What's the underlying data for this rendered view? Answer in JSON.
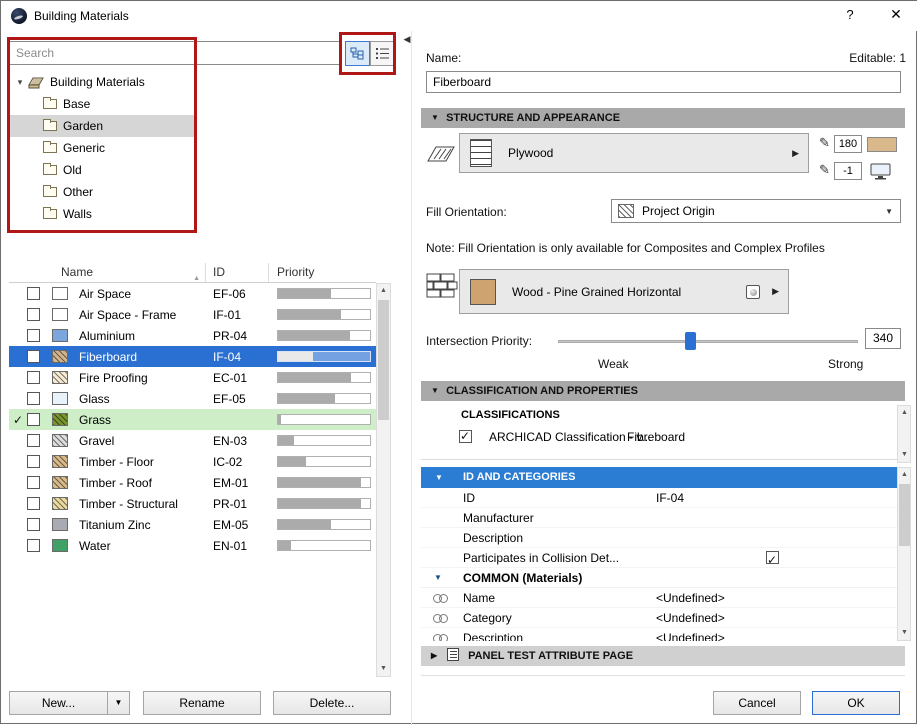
{
  "window": {
    "title": "Building Materials",
    "help": "?",
    "close": "✕"
  },
  "search": {
    "placeholder": "Search"
  },
  "view_toggle": {
    "tree_selected": true
  },
  "tree": {
    "root": "Building Materials",
    "folders": [
      {
        "label": "Base",
        "selected": false
      },
      {
        "label": "Garden",
        "selected": true
      },
      {
        "label": "Generic",
        "selected": false
      },
      {
        "label": "Old",
        "selected": false
      },
      {
        "label": "Other",
        "selected": false
      },
      {
        "label": "Walls",
        "selected": false
      }
    ]
  },
  "table": {
    "columns": [
      "Name",
      "ID",
      "Priority"
    ],
    "sorted_by": "Name",
    "rows": [
      {
        "name": "Air Space",
        "id": "EF-06",
        "priority": 58,
        "swatch": "#ffffff",
        "pattern": "plain",
        "selected": false,
        "active": false
      },
      {
        "name": "Air Space - Frame",
        "id": "IF-01",
        "priority": 68,
        "swatch": "#ffffff",
        "pattern": "plain",
        "selected": false,
        "active": false
      },
      {
        "name": "Aluminium",
        "id": "PR-04",
        "priority": 78,
        "swatch": "#7da7dc",
        "pattern": "plain",
        "selected": false,
        "active": false
      },
      {
        "name": "Fiberboard",
        "id": "IF-04",
        "priority": 38,
        "swatch": "#d2b48c",
        "pattern": "hatch",
        "selected": true,
        "active": false
      },
      {
        "name": "Fire Proofing",
        "id": "EC-01",
        "priority": 79,
        "swatch": "#f7ead2",
        "pattern": "hatch",
        "selected": false,
        "active": false
      },
      {
        "name": "Glass",
        "id": "EF-05",
        "priority": 62,
        "swatch": "#e8f2fb",
        "pattern": "plain",
        "selected": false,
        "active": false
      },
      {
        "name": "Grass",
        "id": "",
        "priority": 3,
        "swatch": "#79952e",
        "pattern": "hatch",
        "selected": false,
        "active": true
      },
      {
        "name": "Gravel",
        "id": "EN-03",
        "priority": 17,
        "swatch": "#dcdcdc",
        "pattern": "hatch",
        "selected": false,
        "active": false
      },
      {
        "name": "Timber - Floor",
        "id": "IC-02",
        "priority": 30,
        "swatch": "#d8b98a",
        "pattern": "hatch",
        "selected": false,
        "active": false
      },
      {
        "name": "Timber - Roof",
        "id": "EM-01",
        "priority": 90,
        "swatch": "#d8b98a",
        "pattern": "hatch",
        "selected": false,
        "active": false
      },
      {
        "name": "Timber - Structural",
        "id": "PR-01",
        "priority": 90,
        "swatch": "#ead9a0",
        "pattern": "hatch",
        "selected": false,
        "active": false
      },
      {
        "name": "Titanium Zinc",
        "id": "EM-05",
        "priority": 58,
        "swatch": "#a9abb3",
        "pattern": "plain",
        "selected": false,
        "active": false
      },
      {
        "name": "Water",
        "id": "EN-01",
        "priority": 14,
        "swatch": "#41a066",
        "pattern": "plain",
        "selected": false,
        "active": false
      }
    ]
  },
  "left_buttons": {
    "new": "New...",
    "rename": "Rename",
    "delete": "Delete..."
  },
  "right": {
    "name_label": "Name:",
    "editable": "Editable: 1",
    "name_value": "Fiberboard",
    "sections": {
      "structure": "STRUCTURE AND APPEARANCE",
      "classification": "CLASSIFICATION AND PROPERTIES",
      "panel_test": "PANEL TEST ATTRIBUTE PAGE"
    },
    "cut_fill": {
      "fill_name": "Plywood",
      "fg_pen": "180",
      "bg_pen": "-1"
    },
    "fill_orientation": {
      "label": "Fill Orientation:",
      "value": "Project Origin"
    },
    "note": "Note: Fill Orientation is only available for Composites and Complex Profiles",
    "surface": {
      "name": "Wood - Pine Grained Horizontal"
    },
    "intersection": {
      "label": "Intersection Priority:",
      "weak": "Weak",
      "strong": "Strong",
      "value": "340",
      "percent": 44
    },
    "classifications": {
      "title": "CLASSIFICATIONS",
      "system": "ARCHICAD Classification - v...",
      "value": "Fibreboard",
      "checked": true
    },
    "prop_grid": [
      {
        "type": "blueheader",
        "label": "ID AND CATEGORIES"
      },
      {
        "type": "row",
        "label": "ID",
        "value": "IF-04"
      },
      {
        "type": "row",
        "label": "Manufacturer",
        "value": ""
      },
      {
        "type": "row",
        "label": "Description",
        "value": ""
      },
      {
        "type": "rowcheck",
        "label": "Participates in Collision Det...",
        "checked": true
      },
      {
        "type": "group",
        "label": "COMMON (Materials)"
      },
      {
        "type": "linkrow",
        "label": "Name",
        "value": "<Undefined>"
      },
      {
        "type": "linkrow",
        "label": "Category",
        "value": "<Undefined>"
      },
      {
        "type": "linkrow",
        "label": "Description",
        "value": "<Undefined>"
      }
    ],
    "buttons": {
      "cancel": "Cancel",
      "ok": "OK"
    }
  },
  "colors": {
    "selection_blue": "#2a6fd2",
    "grass_highlight": "#cdeec6",
    "section_header_gray": "#a9a9a9",
    "prop_header_blue": "#2b7cd3",
    "annotation_red": "#b01818"
  }
}
